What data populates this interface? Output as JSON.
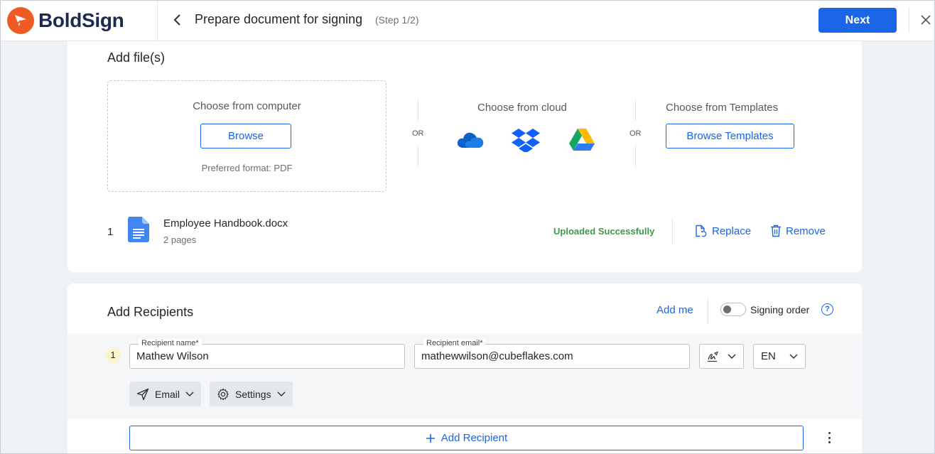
{
  "app": {
    "name": "BoldSign",
    "brand_color": "#ef5b25",
    "accent_color": "#1a66e6"
  },
  "header": {
    "title": "Prepare document for signing",
    "step": "(Step 1/2)",
    "next_label": "Next",
    "back_icon": "chevron-left-icon",
    "close_icon": "close-icon"
  },
  "add_files": {
    "title": "Add file(s)",
    "computer": {
      "title": "Choose from computer",
      "button": "Browse",
      "hint": "Preferred format: PDF"
    },
    "or_label": "OR",
    "cloud": {
      "title": "Choose from cloud",
      "providers": [
        "onedrive-icon",
        "dropbox-icon",
        "google-drive-icon"
      ]
    },
    "templates": {
      "title": "Choose from Templates",
      "button": "Browse Templates"
    },
    "files": [
      {
        "index": "1",
        "name": "Employee Handbook.docx",
        "pages": "2 pages",
        "status": "Uploaded Successfully",
        "replace_label": "Replace",
        "remove_label": "Remove"
      }
    ]
  },
  "recipients": {
    "title": "Add Recipients",
    "add_me": "Add me",
    "signing_order_label": "Signing order",
    "signing_order_enabled": false,
    "help": "?",
    "list": [
      {
        "index": "1",
        "name_label": "Recipient name*",
        "name": "Mathew Wilson",
        "email_label": "Recipient email*",
        "email": "mathewwilson@cubeflakes.com",
        "role_icon": "signer-icon",
        "language": "EN",
        "delivery": "Email",
        "settings": "Settings"
      }
    ],
    "add_recipient_label": "Add Recipient"
  }
}
